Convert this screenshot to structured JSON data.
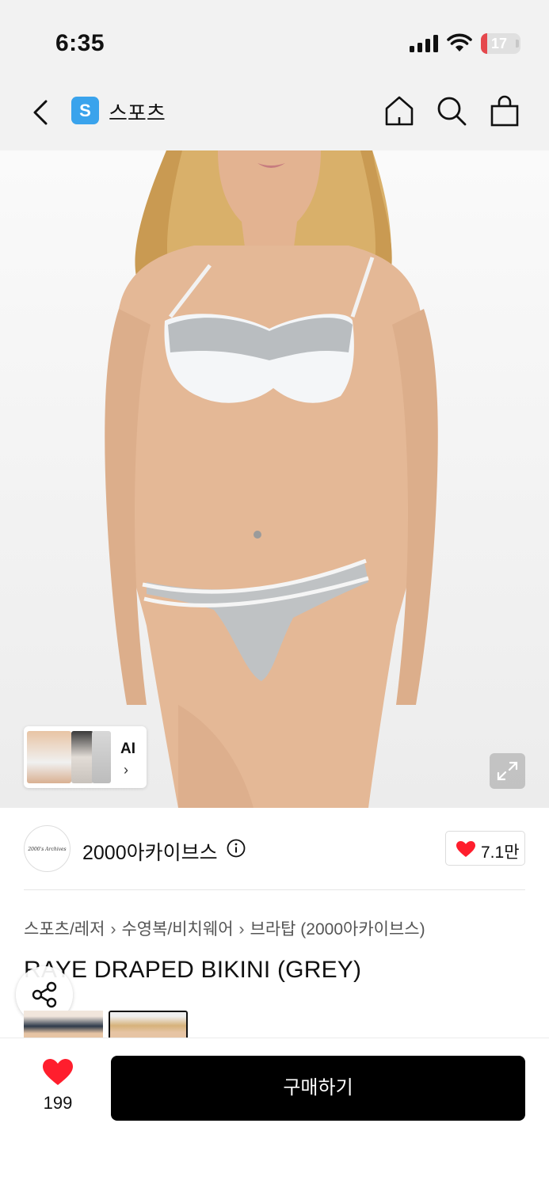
{
  "status_bar": {
    "time": "6:35",
    "battery": "17",
    "battery_level_percent": 17,
    "battery_color": "#e5484d"
  },
  "header": {
    "back_icon": "chevron-left-icon",
    "store_badge": "S",
    "store_badge_color": "#3aa3ec",
    "title": "스포츠",
    "actions": [
      "home-icon",
      "search-icon",
      "shopping-bag-icon"
    ]
  },
  "gallery": {
    "ai_label": "AI",
    "ai_chevron": "›",
    "expand_icon": "expand-icon"
  },
  "brand": {
    "logo_text": "2000's Archives",
    "name": "2000아카이브스",
    "info_icon": "info-icon",
    "like_count": "7.1만"
  },
  "breadcrumb": {
    "items": [
      "스포츠/레저",
      "수영복/비치웨어",
      "브라탑 (2000아카이브스)"
    ],
    "separator": "›"
  },
  "product": {
    "title": "RAYE DRAPED BIKINI (GREY)"
  },
  "bottom_bar": {
    "wish_count": "199",
    "buy_label": "구매하기",
    "heart_color": "#ff1e2d"
  }
}
